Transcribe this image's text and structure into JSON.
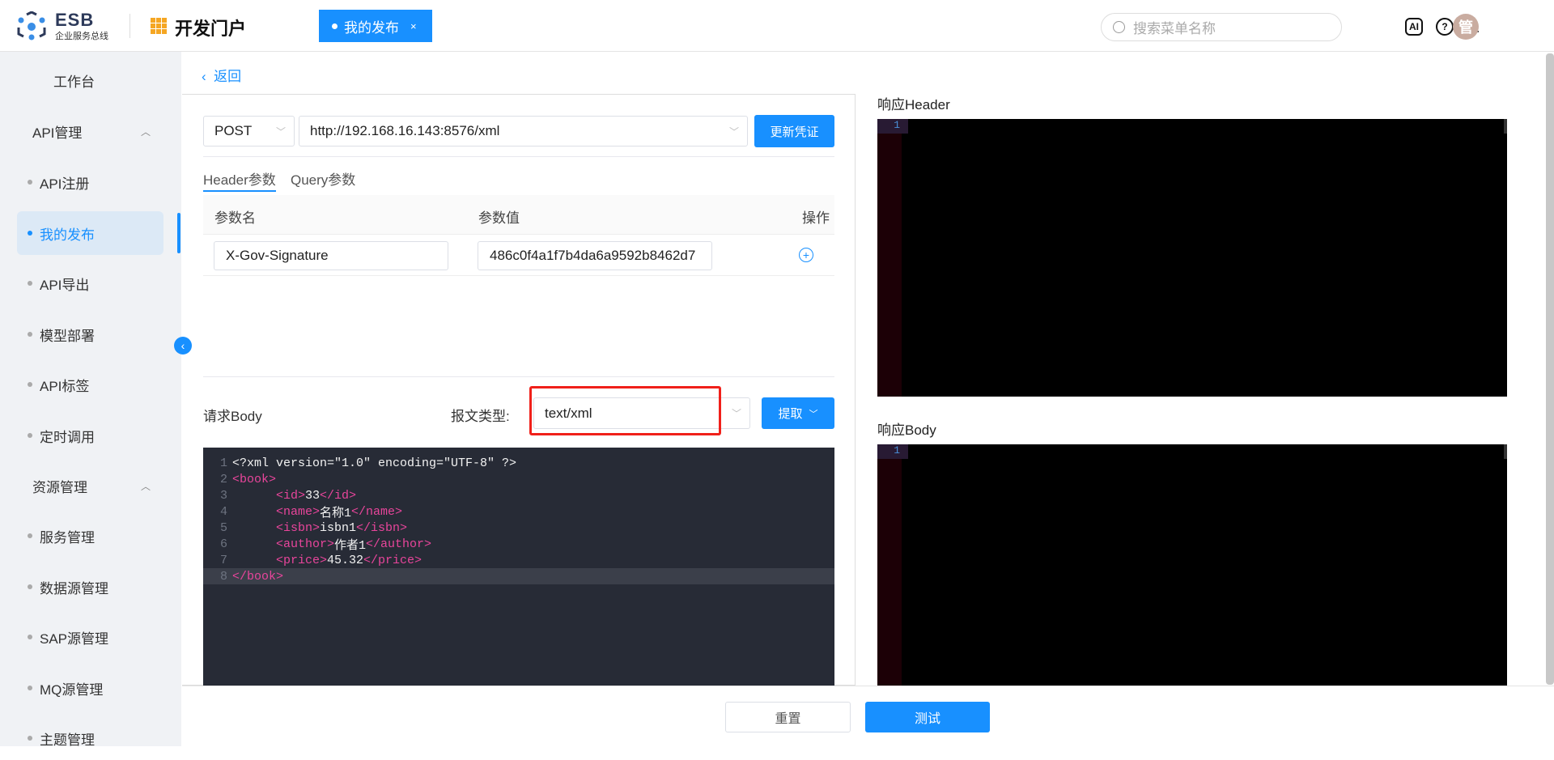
{
  "header": {
    "logo_title": "ESB",
    "logo_subtitle": "企业服务总线",
    "portal": "开发门户",
    "tab": "我的发布",
    "tab_close": "×",
    "search_placeholder": "搜索菜单名称",
    "ai_icon": "AI",
    "help_icon": "?",
    "avatar": "管"
  },
  "sidebar": {
    "items": [
      {
        "label": "工作台",
        "type": "top"
      },
      {
        "label": "API管理",
        "type": "group"
      },
      {
        "label": "API注册",
        "type": "sub"
      },
      {
        "label": "我的发布",
        "type": "sub",
        "active": true
      },
      {
        "label": "API导出",
        "type": "sub"
      },
      {
        "label": "模型部署",
        "type": "sub"
      },
      {
        "label": "API标签",
        "type": "sub"
      },
      {
        "label": "定时调用",
        "type": "sub"
      },
      {
        "label": "资源管理",
        "type": "group"
      },
      {
        "label": "服务管理",
        "type": "sub"
      },
      {
        "label": "数据源管理",
        "type": "sub"
      },
      {
        "label": "SAP源管理",
        "type": "sub"
      },
      {
        "label": "MQ源管理",
        "type": "sub"
      },
      {
        "label": "主题管理",
        "type": "sub"
      }
    ]
  },
  "main": {
    "back": "返回",
    "method": "POST",
    "url": "http://192.168.16.143:8576/xml",
    "refresh_btn": "更新凭证",
    "tabs": [
      "Header参数",
      "Query参数"
    ],
    "table": {
      "headers": [
        "参数名",
        "参数值",
        "操作"
      ],
      "rows": [
        {
          "name": "X-Gov-Signature",
          "value": "486c0f4a1f7b4da6a9592b8462d7"
        }
      ]
    },
    "body_label": "请求Body",
    "content_type_label": "报文类型:",
    "content_type": "text/xml",
    "extract_btn": "提取",
    "code_lines": [
      [
        {
          "t": "<?xml version=\"1.0\" encoding=\"UTF-8\" ?>",
          "c": "code"
        }
      ],
      [
        {
          "t": "<book>",
          "c": "tg"
        }
      ],
      [
        {
          "t": "      ",
          "c": "code"
        },
        {
          "t": "<id>",
          "c": "tg"
        },
        {
          "t": "33",
          "c": "code"
        },
        {
          "t": "</id>",
          "c": "tg"
        }
      ],
      [
        {
          "t": "      ",
          "c": "code"
        },
        {
          "t": "<name>",
          "c": "tg"
        },
        {
          "t": "名称1",
          "c": "code"
        },
        {
          "t": "</name>",
          "c": "tg"
        }
      ],
      [
        {
          "t": "      ",
          "c": "code"
        },
        {
          "t": "<isbn>",
          "c": "tg"
        },
        {
          "t": "isbn1",
          "c": "code"
        },
        {
          "t": "</isbn>",
          "c": "tg"
        }
      ],
      [
        {
          "t": "      ",
          "c": "code"
        },
        {
          "t": "<author>",
          "c": "tg"
        },
        {
          "t": "作者1",
          "c": "code"
        },
        {
          "t": "</author>",
          "c": "tg"
        }
      ],
      [
        {
          "t": "      ",
          "c": "code"
        },
        {
          "t": "<price>",
          "c": "tg"
        },
        {
          "t": "45.32",
          "c": "code"
        },
        {
          "t": "</price>",
          "c": "tg"
        }
      ],
      [
        {
          "t": "</book>",
          "c": "tg"
        }
      ]
    ]
  },
  "response": {
    "header_label": "响应Header",
    "body_label": "响应Body",
    "header_line": "1",
    "body_line": "1"
  },
  "footer": {
    "reset": "重置",
    "test": "测试"
  }
}
